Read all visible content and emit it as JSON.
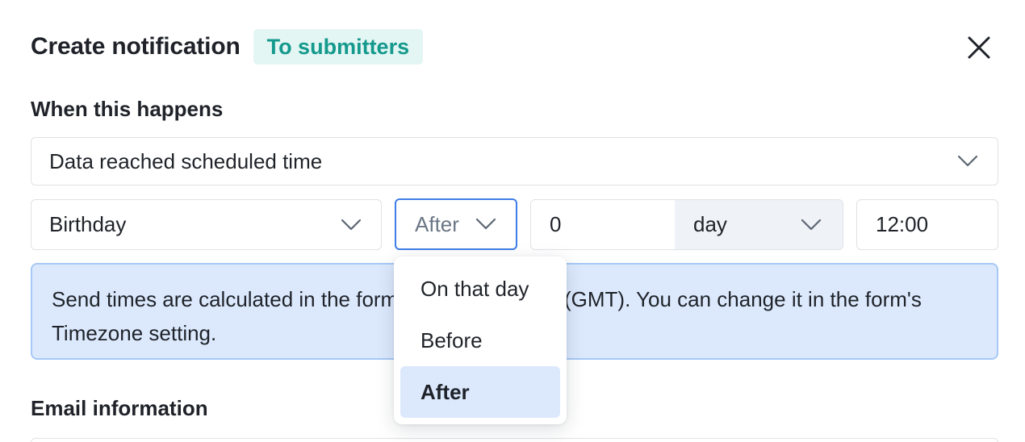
{
  "header": {
    "title": "Create notification",
    "badge": "To submitters"
  },
  "trigger_section": {
    "label": "When this happens",
    "trigger_value": "Data reached scheduled time",
    "field_value": "Birthday",
    "relation_value": "After",
    "offset_value": "0",
    "unit_value": "day",
    "time_value": "12:00"
  },
  "info": {
    "text": "Send times are calculated in the form's timezone: UTC (GMT). You can change it in the form's Timezone setting."
  },
  "email_section": {
    "label": "Email information"
  },
  "relation_dropdown": {
    "options": [
      "On that day",
      "Before",
      "After"
    ],
    "selected": "After"
  },
  "colors": {
    "accent": "#3f7de8",
    "badge_text": "#14998c",
    "badge_bg": "#e3f6f4",
    "info_bg": "#dce9fd",
    "info_border": "#a6c8f6"
  },
  "icons": {
    "close": "close-icon",
    "chevron": "chevron-down-icon"
  }
}
